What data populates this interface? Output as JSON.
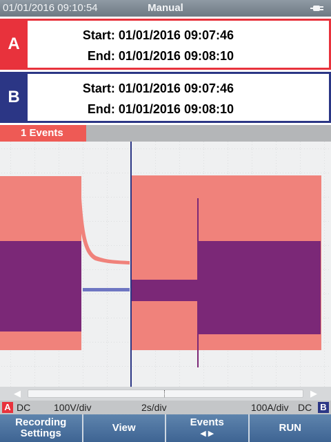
{
  "topbar": {
    "datetime": "01/01/2016 09:10:54",
    "mode": "Manual",
    "power_icon": "plug-icon"
  },
  "channel_a": {
    "tag": "A",
    "start": "Start: 01/01/2016 09:07:46",
    "end": "End: 01/01/2016 09:08:10",
    "color": "#e8323c"
  },
  "channel_b": {
    "tag": "B",
    "start": "Start: 01/01/2016 09:07:46",
    "end": "End: 01/01/2016 09:08:10",
    "color": "#2b3685"
  },
  "events": {
    "label": "1 Events"
  },
  "scale": {
    "a_tag": "A",
    "a_coupling": "DC",
    "a_scale": "100V/div",
    "time_scale": "2s/div",
    "b_scale": "100A/div",
    "b_coupling": "DC",
    "b_tag": "B"
  },
  "softkeys": {
    "recording_l1": "Recording",
    "recording_l2": "Settings",
    "view": "View",
    "events": "Events",
    "events_arrows": "◀ ▶",
    "run": "RUN"
  },
  "colors": {
    "trace_voltage": "#f0827b",
    "trace_current": "#7b2877",
    "cursor": "#2b3685"
  }
}
